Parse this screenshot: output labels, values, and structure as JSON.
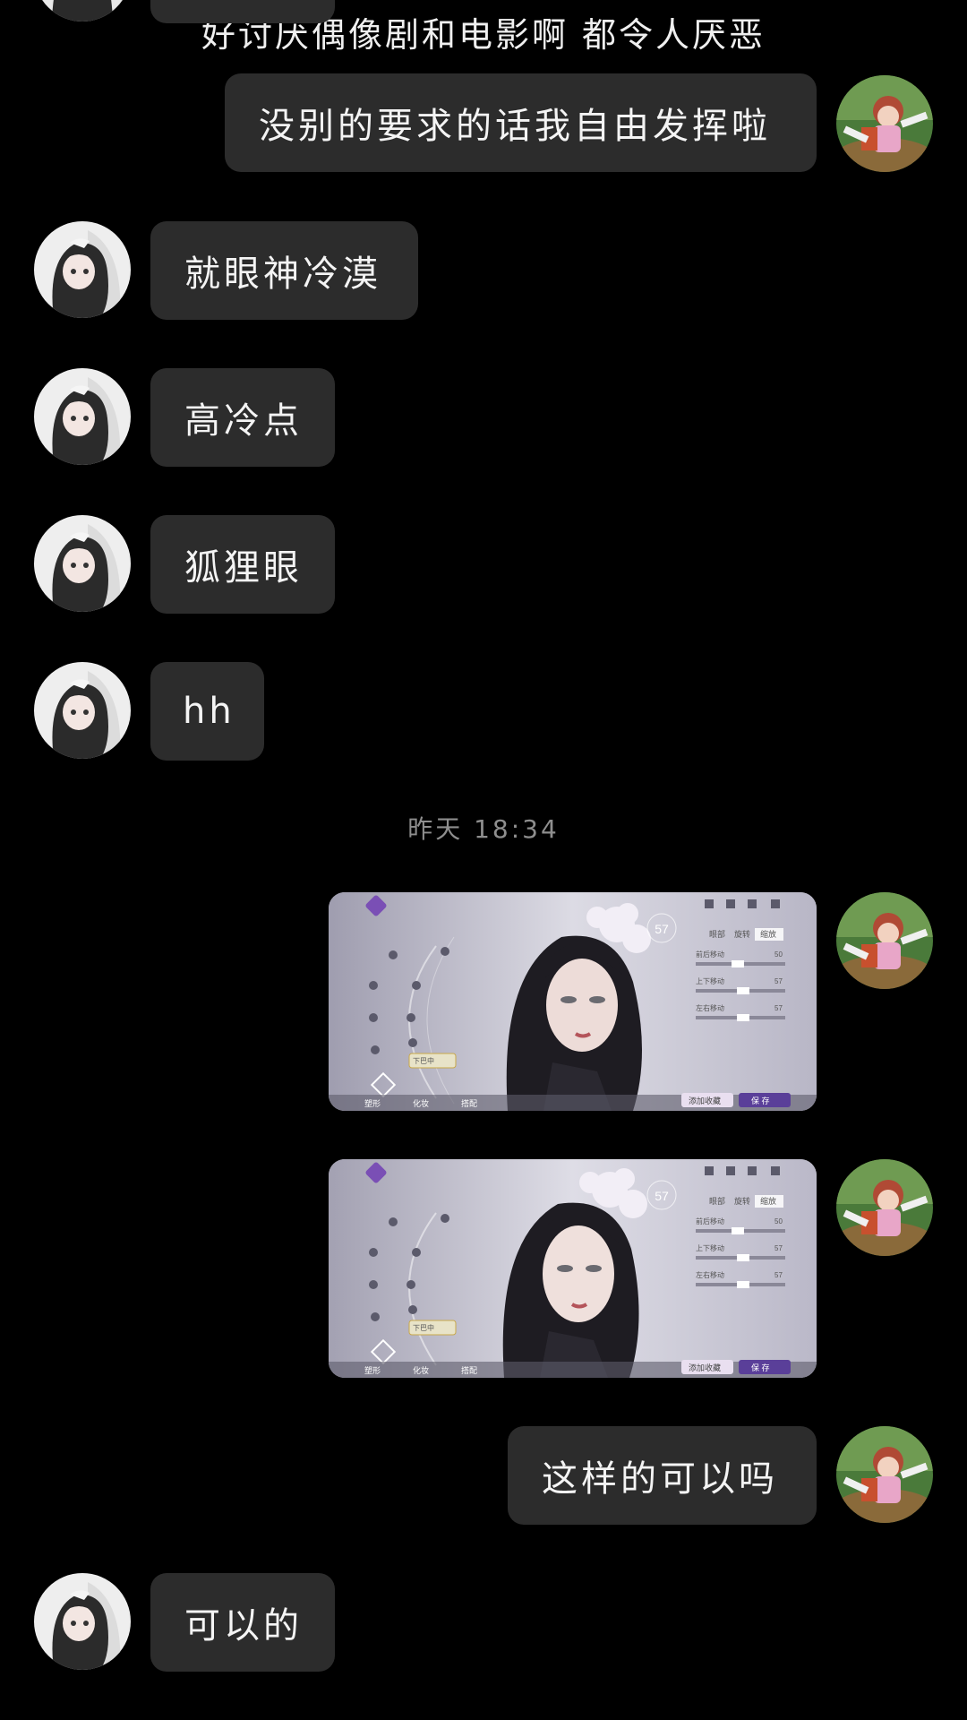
{
  "chat": {
    "top_partial_text": "好讨厌偶像剧和电影啊 都令人厌恶",
    "messages": [
      {
        "side": "right",
        "type": "text",
        "text": "没别的要求的话我自由发挥啦"
      },
      {
        "side": "left",
        "type": "text",
        "text": "就眼神冷漠"
      },
      {
        "side": "left",
        "type": "text",
        "text": "高冷点"
      },
      {
        "side": "left",
        "type": "text",
        "text": "狐狸眼"
      },
      {
        "side": "left",
        "type": "text",
        "text": "hh"
      },
      {
        "side": "right",
        "type": "image"
      },
      {
        "side": "right",
        "type": "image"
      },
      {
        "side": "right",
        "type": "text",
        "text": "这样的可以吗"
      },
      {
        "side": "left",
        "type": "text",
        "text": "可以的"
      }
    ],
    "timestamp": "昨天 18:34"
  },
  "game_screenshot": {
    "level_badge": "57",
    "tabs": [
      "眼部",
      "旋转",
      "缩放"
    ],
    "sliders": [
      {
        "label": "前后移动",
        "value": "50"
      },
      {
        "label": "上下移动",
        "value": "57"
      },
      {
        "label": "左右移动",
        "value": "57"
      }
    ],
    "bottom_tabs": [
      "塑形",
      "化妆",
      "搭配"
    ],
    "hint_label": "下巴中",
    "buttons": {
      "left": "添加收藏",
      "right": "保 存"
    }
  },
  "colors": {
    "background": "#000000",
    "bubble": "#2c2c2c",
    "text": "#f4f4f4",
    "timestamp": "#8e8e8e"
  }
}
